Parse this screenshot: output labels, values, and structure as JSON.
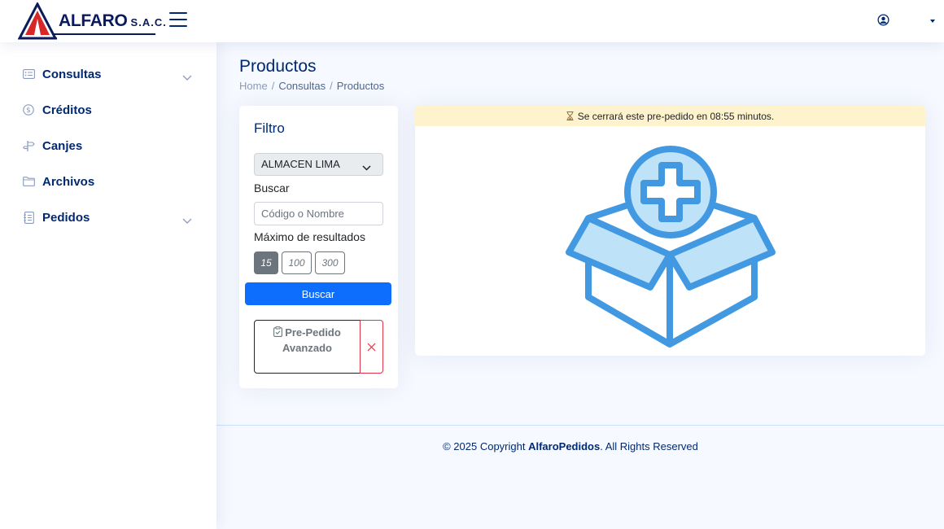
{
  "header": {
    "logo_text": "ALFARO",
    "logo_suffix": "S.A.C."
  },
  "sidebar": {
    "items": [
      {
        "label": "Consultas",
        "icon": "card-list-icon",
        "has_chevron": true
      },
      {
        "label": "Créditos",
        "icon": "coin-icon",
        "has_chevron": false
      },
      {
        "label": "Canjes",
        "icon": "signpost-icon",
        "has_chevron": false
      },
      {
        "label": "Archivos",
        "icon": "folder-icon",
        "has_chevron": false
      },
      {
        "label": "Pedidos",
        "icon": "journal-icon",
        "has_chevron": true
      }
    ]
  },
  "main": {
    "title": "Productos",
    "breadcrumb": [
      "Home",
      "Consultas",
      "Productos"
    ]
  },
  "filter": {
    "title": "Filtro",
    "warehouse_selected": "ALMACEN LIMA",
    "search_label": "Buscar",
    "search_placeholder": "Código o Nombre",
    "max_results_label": "Máximo de resultados",
    "max_options": [
      "15",
      "100",
      "300"
    ],
    "max_selected": "15",
    "search_button": "Buscar",
    "prepedido_line1": "Pre-Pedido",
    "prepedido_line2": "Avanzado"
  },
  "alert": {
    "text": "Se cerrará este pre-pedido en 08:55 minutos."
  },
  "footer": {
    "prefix": "© 2025 Copyright ",
    "brand": "AlfaroPedidos",
    "suffix": ". All Rights Reserved"
  },
  "colors": {
    "primary": "#0d6efd",
    "navy": "#012970",
    "danger": "#dc3545",
    "alert_bg": "#fff3cd",
    "illustration_stroke": "#4299e1",
    "illustration_fill": "#bee3f8"
  }
}
